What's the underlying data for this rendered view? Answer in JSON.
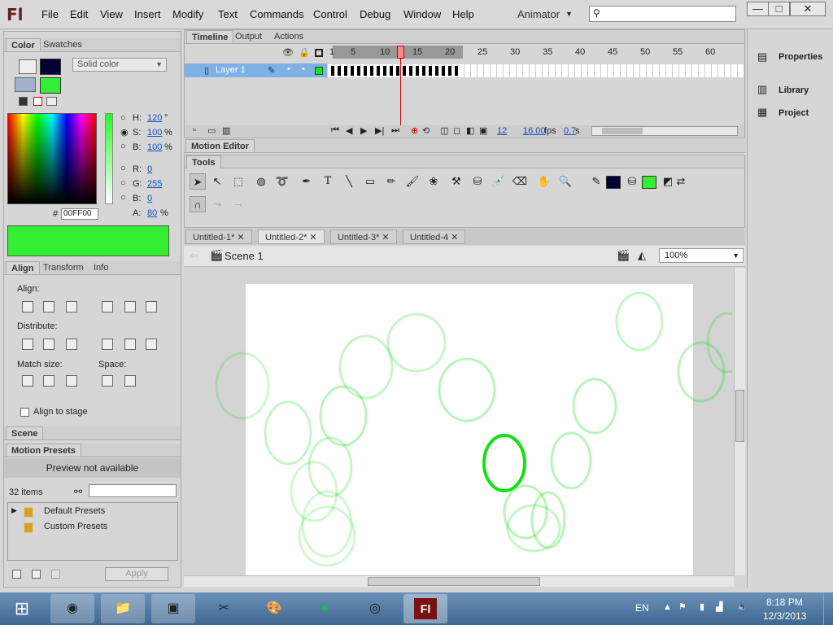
{
  "app": {
    "logo": "Fl",
    "menus": [
      "File",
      "Edit",
      "View",
      "Insert",
      "Modify",
      "Text",
      "Commands",
      "Control",
      "Debug",
      "Window",
      "Help"
    ],
    "workspace": "Animator",
    "window_buttons": [
      "—",
      "□",
      "✕"
    ]
  },
  "color_panel": {
    "tabs": [
      "Color",
      "Swatches"
    ],
    "fill_type": "Solid color",
    "h_label": "H:",
    "h": "120",
    "h_unit": "°",
    "s_label": "S:",
    "s": "100",
    "s_unit": "%",
    "b_label": "B:",
    "b": "100",
    "b_unit": "%",
    "r_label": "R:",
    "r": "0",
    "g_label": "G:",
    "g": "255",
    "bl_label": "B:",
    "bl": "0",
    "a_label": "A:",
    "a": "80",
    "a_unit": "%",
    "hex_label": "#",
    "hex": "00FF00",
    "stroke_color": "#000033",
    "fill_color": "#33ee33"
  },
  "align_panel": {
    "tabs": [
      "Align",
      "Transform",
      "Info"
    ],
    "align": "Align:",
    "distribute": "Distribute:",
    "match_size": "Match size:",
    "space": "Space:",
    "align_to_stage": "Align to stage"
  },
  "scene_panel": {
    "title": "Scene"
  },
  "motion_presets": {
    "title": "Motion Presets",
    "preview": "Preview not available",
    "count": "32 items",
    "folders": [
      "Default Presets",
      "Custom Presets"
    ],
    "apply": "Apply"
  },
  "timeline": {
    "tabs": [
      "Timeline",
      "Output",
      "Actions"
    ],
    "layer": "Layer 1",
    "frame_numbers": [
      "1",
      "5",
      "10",
      "15",
      "20",
      "25",
      "30",
      "35",
      "40",
      "45",
      "50",
      "55",
      "60"
    ],
    "current_frame": "12",
    "fps": "16.00",
    "fps_unit": "fps",
    "time": "0.7",
    "time_unit": "s"
  },
  "motion_editor": {
    "title": "Motion Editor"
  },
  "tools": {
    "title": "Tools",
    "stroke_color": "#000033",
    "fill_color": "#33ee33"
  },
  "documents": {
    "tabs": [
      "Untitled-1*",
      "Untitled-2*",
      "Untitled-3*",
      "Untitled-4"
    ],
    "active": 1,
    "scene": "Scene 1",
    "zoom": "100%"
  },
  "right_panel": {
    "items": [
      "Properties",
      "Library",
      "Project"
    ]
  },
  "taskbar": {
    "lang": "EN",
    "time": "8:18 PM",
    "date": "12/3/2013"
  }
}
